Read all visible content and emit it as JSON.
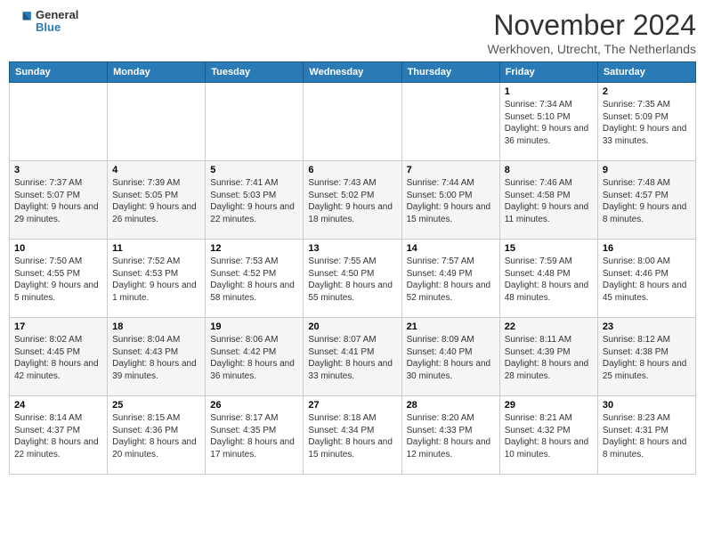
{
  "header": {
    "logo_general": "General",
    "logo_blue": "Blue",
    "month_title": "November 2024",
    "subtitle": "Werkhoven, Utrecht, The Netherlands"
  },
  "weekdays": [
    "Sunday",
    "Monday",
    "Tuesday",
    "Wednesday",
    "Thursday",
    "Friday",
    "Saturday"
  ],
  "weeks": [
    [
      {
        "day": "",
        "info": ""
      },
      {
        "day": "",
        "info": ""
      },
      {
        "day": "",
        "info": ""
      },
      {
        "day": "",
        "info": ""
      },
      {
        "day": "",
        "info": ""
      },
      {
        "day": "1",
        "info": "Sunrise: 7:34 AM\nSunset: 5:10 PM\nDaylight: 9 hours\nand 36 minutes."
      },
      {
        "day": "2",
        "info": "Sunrise: 7:35 AM\nSunset: 5:09 PM\nDaylight: 9 hours\nand 33 minutes."
      }
    ],
    [
      {
        "day": "3",
        "info": "Sunrise: 7:37 AM\nSunset: 5:07 PM\nDaylight: 9 hours\nand 29 minutes."
      },
      {
        "day": "4",
        "info": "Sunrise: 7:39 AM\nSunset: 5:05 PM\nDaylight: 9 hours\nand 26 minutes."
      },
      {
        "day": "5",
        "info": "Sunrise: 7:41 AM\nSunset: 5:03 PM\nDaylight: 9 hours\nand 22 minutes."
      },
      {
        "day": "6",
        "info": "Sunrise: 7:43 AM\nSunset: 5:02 PM\nDaylight: 9 hours\nand 18 minutes."
      },
      {
        "day": "7",
        "info": "Sunrise: 7:44 AM\nSunset: 5:00 PM\nDaylight: 9 hours\nand 15 minutes."
      },
      {
        "day": "8",
        "info": "Sunrise: 7:46 AM\nSunset: 4:58 PM\nDaylight: 9 hours\nand 11 minutes."
      },
      {
        "day": "9",
        "info": "Sunrise: 7:48 AM\nSunset: 4:57 PM\nDaylight: 9 hours\nand 8 minutes."
      }
    ],
    [
      {
        "day": "10",
        "info": "Sunrise: 7:50 AM\nSunset: 4:55 PM\nDaylight: 9 hours\nand 5 minutes."
      },
      {
        "day": "11",
        "info": "Sunrise: 7:52 AM\nSunset: 4:53 PM\nDaylight: 9 hours\nand 1 minute."
      },
      {
        "day": "12",
        "info": "Sunrise: 7:53 AM\nSunset: 4:52 PM\nDaylight: 8 hours\nand 58 minutes."
      },
      {
        "day": "13",
        "info": "Sunrise: 7:55 AM\nSunset: 4:50 PM\nDaylight: 8 hours\nand 55 minutes."
      },
      {
        "day": "14",
        "info": "Sunrise: 7:57 AM\nSunset: 4:49 PM\nDaylight: 8 hours\nand 52 minutes."
      },
      {
        "day": "15",
        "info": "Sunrise: 7:59 AM\nSunset: 4:48 PM\nDaylight: 8 hours\nand 48 minutes."
      },
      {
        "day": "16",
        "info": "Sunrise: 8:00 AM\nSunset: 4:46 PM\nDaylight: 8 hours\nand 45 minutes."
      }
    ],
    [
      {
        "day": "17",
        "info": "Sunrise: 8:02 AM\nSunset: 4:45 PM\nDaylight: 8 hours\nand 42 minutes."
      },
      {
        "day": "18",
        "info": "Sunrise: 8:04 AM\nSunset: 4:43 PM\nDaylight: 8 hours\nand 39 minutes."
      },
      {
        "day": "19",
        "info": "Sunrise: 8:06 AM\nSunset: 4:42 PM\nDaylight: 8 hours\nand 36 minutes."
      },
      {
        "day": "20",
        "info": "Sunrise: 8:07 AM\nSunset: 4:41 PM\nDaylight: 8 hours\nand 33 minutes."
      },
      {
        "day": "21",
        "info": "Sunrise: 8:09 AM\nSunset: 4:40 PM\nDaylight: 8 hours\nand 30 minutes."
      },
      {
        "day": "22",
        "info": "Sunrise: 8:11 AM\nSunset: 4:39 PM\nDaylight: 8 hours\nand 28 minutes."
      },
      {
        "day": "23",
        "info": "Sunrise: 8:12 AM\nSunset: 4:38 PM\nDaylight: 8 hours\nand 25 minutes."
      }
    ],
    [
      {
        "day": "24",
        "info": "Sunrise: 8:14 AM\nSunset: 4:37 PM\nDaylight: 8 hours\nand 22 minutes."
      },
      {
        "day": "25",
        "info": "Sunrise: 8:15 AM\nSunset: 4:36 PM\nDaylight: 8 hours\nand 20 minutes."
      },
      {
        "day": "26",
        "info": "Sunrise: 8:17 AM\nSunset: 4:35 PM\nDaylight: 8 hours\nand 17 minutes."
      },
      {
        "day": "27",
        "info": "Sunrise: 8:18 AM\nSunset: 4:34 PM\nDaylight: 8 hours\nand 15 minutes."
      },
      {
        "day": "28",
        "info": "Sunrise: 8:20 AM\nSunset: 4:33 PM\nDaylight: 8 hours\nand 12 minutes."
      },
      {
        "day": "29",
        "info": "Sunrise: 8:21 AM\nSunset: 4:32 PM\nDaylight: 8 hours\nand 10 minutes."
      },
      {
        "day": "30",
        "info": "Sunrise: 8:23 AM\nSunset: 4:31 PM\nDaylight: 8 hours\nand 8 minutes."
      }
    ]
  ]
}
